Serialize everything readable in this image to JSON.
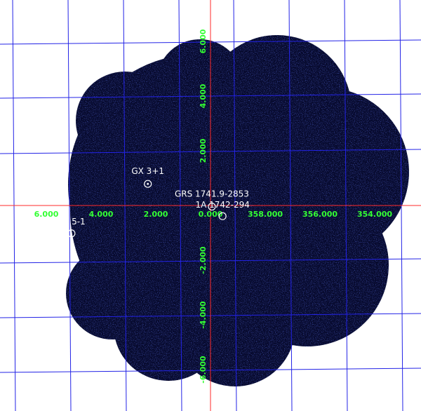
{
  "chart_data": {
    "type": "scatter",
    "grid": true,
    "colors": {
      "background": "#ffffff",
      "field": "#070a2e",
      "speckle": "#1a28c8",
      "grid": "#2323e6",
      "axis": "#ff2b2b",
      "tick_labels": "#33ff33",
      "source_labels": "#ffffff"
    },
    "x_axis": {
      "ticks": [
        "6.000",
        "4.000",
        "2.000",
        "0.000",
        "358.000",
        "356.000",
        "354.000"
      ]
    },
    "y_axis": {
      "ticks": [
        "6.000",
        "4.000",
        "2.000",
        "-2.000",
        "-4.000",
        "-6.000"
      ]
    },
    "sources": [
      {
        "name": "GX 3+1",
        "l": 2.29,
        "b": 0.79
      },
      {
        "name": "GRS 1741.9-2853",
        "l": 359.95,
        "b": -0.04
      },
      {
        "name": "1A 1742-294",
        "l": 359.56,
        "b": -0.39
      },
      {
        "name": "5-1",
        "l": 5.08,
        "b": -1.02
      }
    ]
  }
}
